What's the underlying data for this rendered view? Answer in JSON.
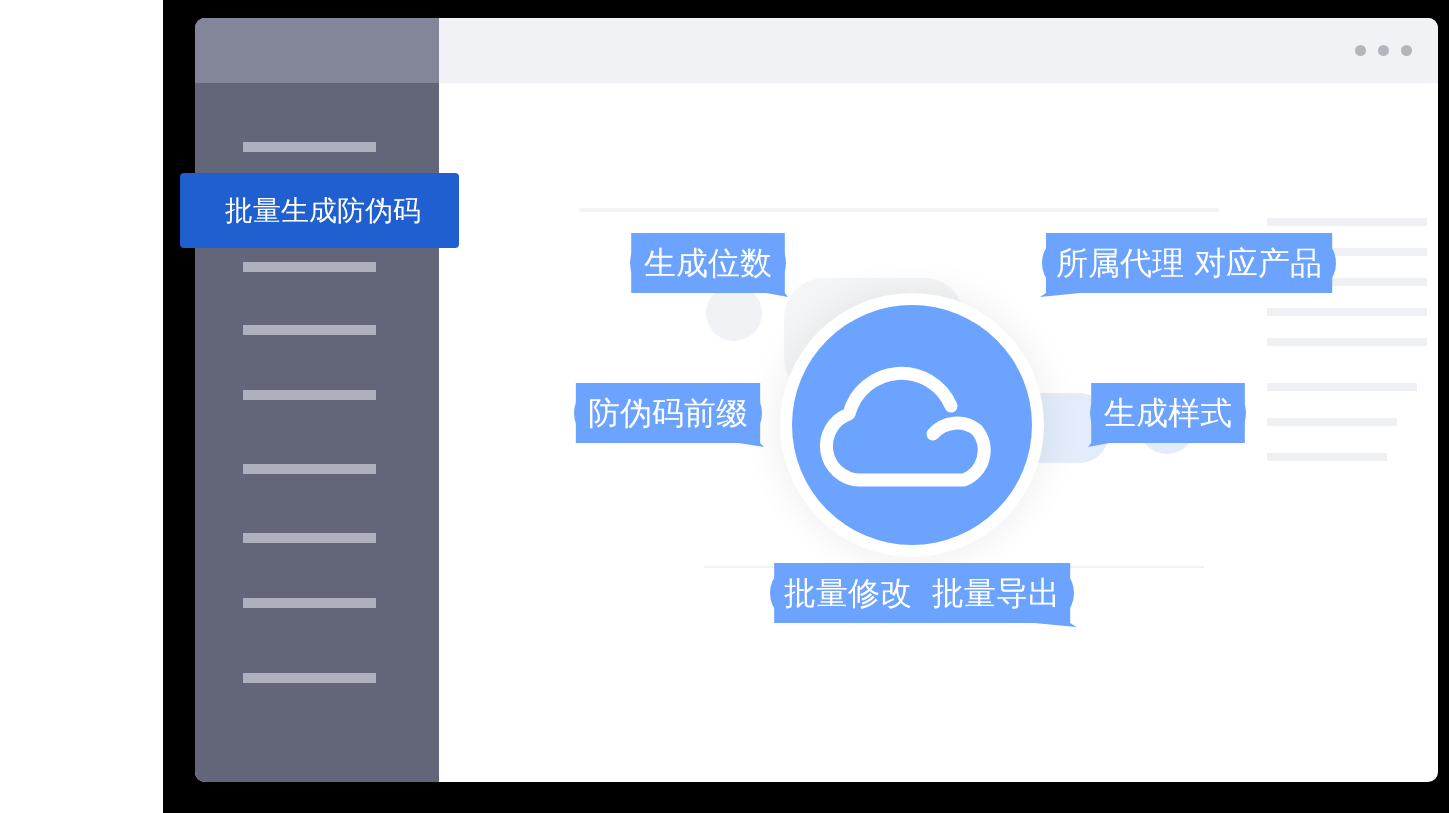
{
  "sidebar": {
    "selected_item": {
      "label": "批量生成防伪码",
      "selected": true
    }
  },
  "bubbles": [
    {
      "label": "生成位数",
      "kind": "rightward"
    },
    {
      "label": "所属代理 对应产品",
      "kind": "leftward"
    },
    {
      "label": "防伪码前缀",
      "kind": "rightward"
    },
    {
      "label": "生成样式",
      "kind": "leftward"
    },
    {
      "label": "批量修改  批量导出",
      "kind": "rightward"
    }
  ]
}
